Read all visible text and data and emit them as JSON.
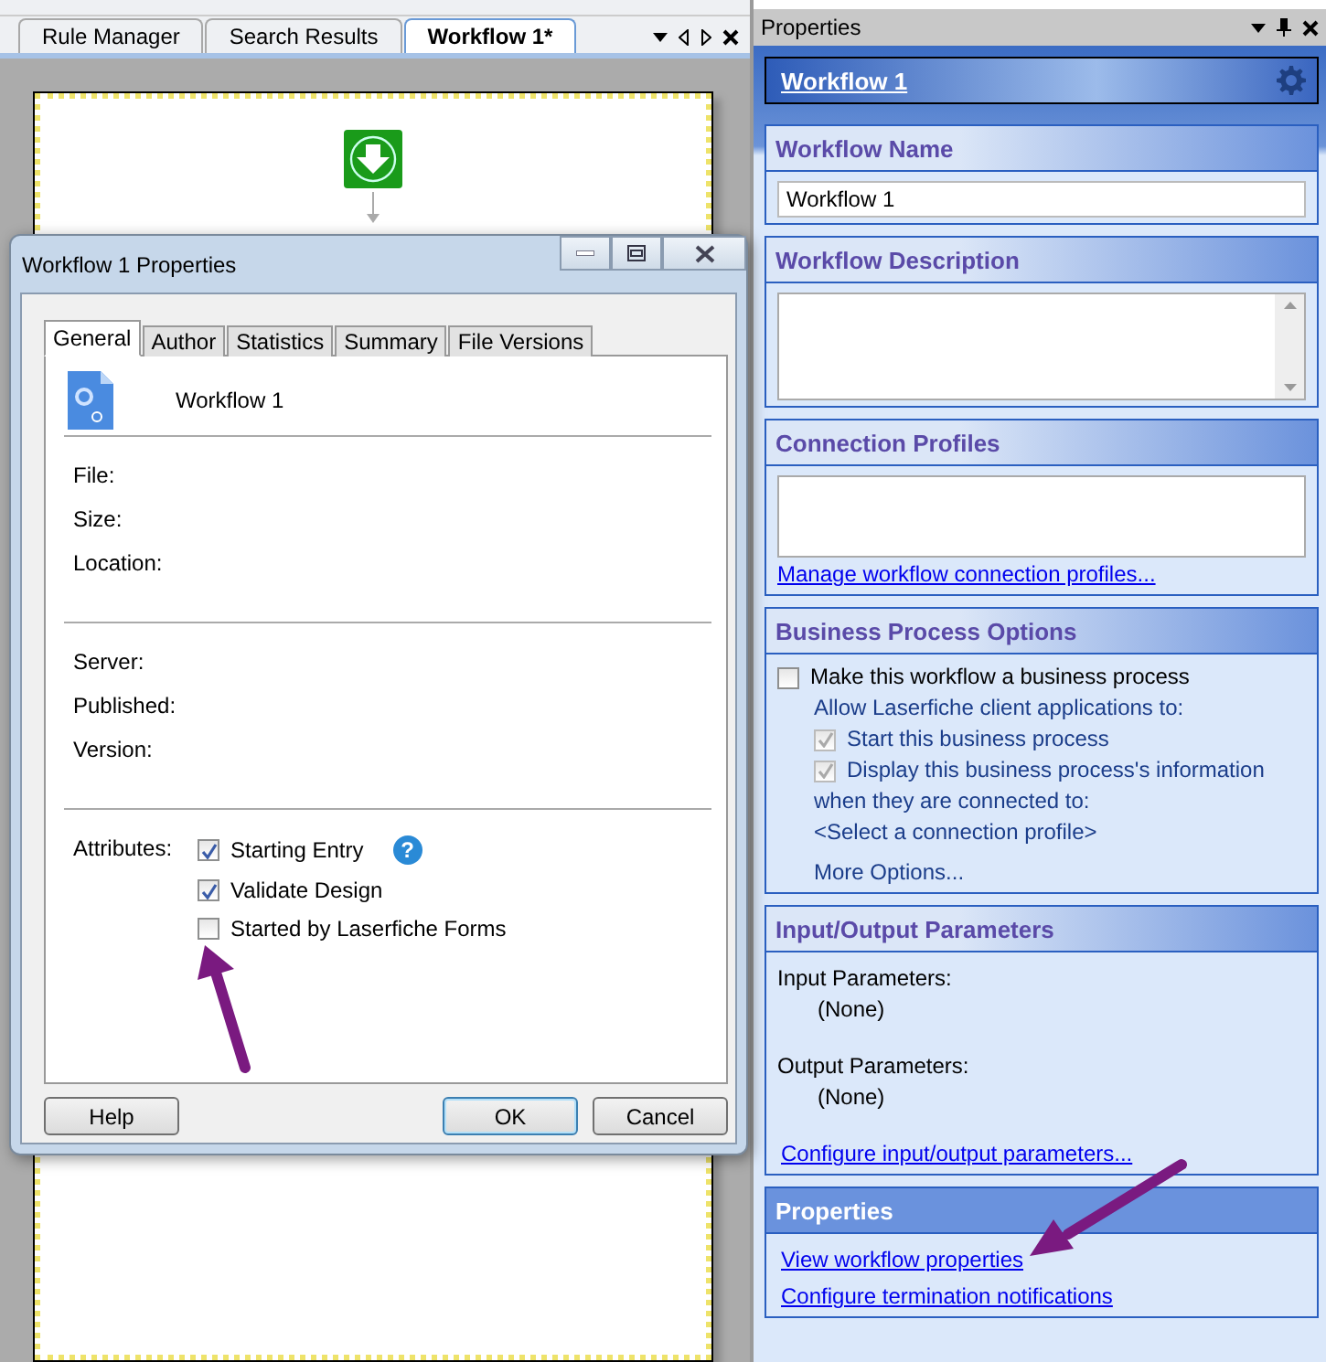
{
  "document_tabs": [
    {
      "label": "Rule Manager",
      "selected": false
    },
    {
      "label": "Search Results",
      "selected": false
    },
    {
      "label": "Workflow 1*",
      "selected": true
    }
  ],
  "dialog": {
    "title": "Workflow 1 Properties",
    "tabs": [
      {
        "label": "General",
        "selected": true
      },
      {
        "label": "Author",
        "selected": false
      },
      {
        "label": "Statistics",
        "selected": false
      },
      {
        "label": "Summary",
        "selected": false
      },
      {
        "label": "File Versions",
        "selected": false
      }
    ],
    "name": "Workflow 1",
    "file_fields": [
      "File:",
      "Size:",
      "Location:"
    ],
    "server_fields": [
      "Server:",
      "Published:",
      "Version:"
    ],
    "attributes_label": "Attributes:",
    "attributes": [
      {
        "label": "Starting Entry",
        "checked": true,
        "help_icon": "?"
      },
      {
        "label": "Validate Design",
        "checked": true
      },
      {
        "label": "Started by Laserfiche Forms",
        "checked": false
      }
    ],
    "buttons": [
      {
        "label": "Help",
        "default": false
      },
      {
        "label": "OK",
        "default": true
      },
      {
        "label": "Cancel",
        "default": false
      }
    ]
  },
  "properties_panel": {
    "title": "Properties",
    "object_title": "Workflow 1",
    "sections": [
      {
        "kind": "name",
        "title": "Workflow Name",
        "value": "Workflow 1"
      },
      {
        "kind": "description",
        "title": "Workflow Description"
      },
      {
        "kind": "profiles",
        "title": "Connection Profiles",
        "link": "Manage workflow connection profiles..."
      },
      {
        "kind": "business",
        "title": "Business Process Options",
        "option": {
          "label": "Make this workflow a business process",
          "checked": false
        },
        "allow_text": "Allow Laserfiche client applications to:",
        "allow_options": [
          {
            "label": "Start this business process",
            "checked": true,
            "disabled": true
          },
          {
            "label": "Display this business process's information",
            "checked": true,
            "disabled": true
          }
        ],
        "connected_text": "when they are connected to:",
        "profile": "<Select a connection profile>",
        "more": "More Options..."
      },
      {
        "kind": "params",
        "title": "Input/Output Parameters",
        "groups": [
          {
            "label": "Input Parameters:",
            "value": "(None)"
          },
          {
            "label": "Output Parameters:",
            "value": "(None)"
          }
        ],
        "link": "Configure input/output parameters..."
      },
      {
        "kind": "links",
        "title": "Properties",
        "links": [
          "View workflow properties",
          "Configure termination notifications"
        ]
      }
    ]
  }
}
